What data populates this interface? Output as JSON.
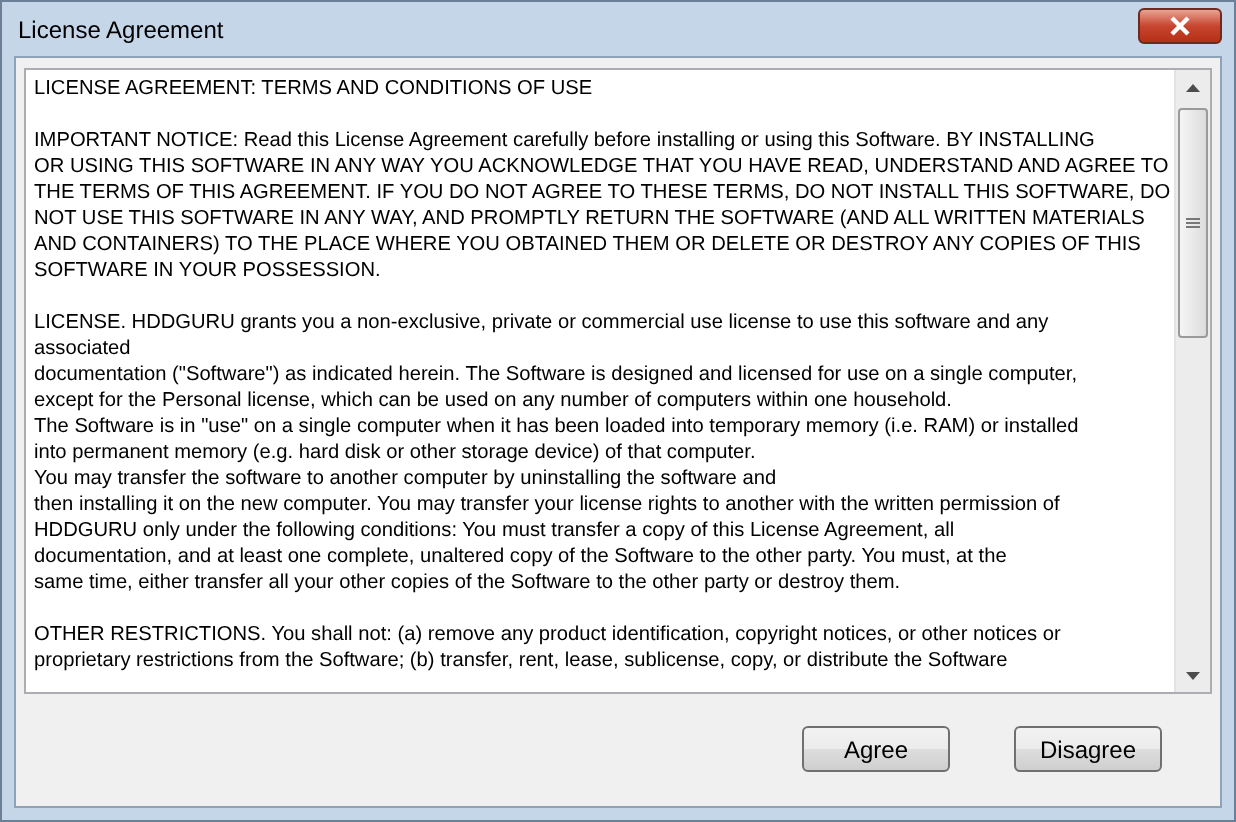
{
  "window": {
    "title": "License Agreement"
  },
  "license_text": {
    "paragraphs": [
      [
        "LICENSE AGREEMENT: TERMS AND CONDITIONS OF USE"
      ],
      [
        "IMPORTANT NOTICE: Read this License Agreement carefully before installing or using this Software. BY INSTALLING",
        "OR USING THIS SOFTWARE IN ANY WAY YOU ACKNOWLEDGE THAT YOU HAVE READ, UNDERSTAND AND AGREE TO",
        "THE TERMS OF THIS AGREEMENT. IF YOU DO NOT AGREE TO THESE TERMS, DO NOT INSTALL THIS SOFTWARE, DO",
        "NOT USE THIS SOFTWARE IN ANY WAY, AND PROMPTLY RETURN THE SOFTWARE (AND ALL WRITTEN MATERIALS",
        "AND CONTAINERS) TO THE PLACE WHERE YOU OBTAINED THEM OR DELETE OR DESTROY ANY COPIES OF THIS",
        "SOFTWARE IN YOUR POSSESSION."
      ],
      [
        "LICENSE. HDDGURU grants you a non-exclusive, private or commercial use license to use this software and any",
        "associated",
        "documentation (\"Software\") as indicated herein.  The Software is designed and licensed for use on a single computer,",
        "except for the Personal license, which can be used on any number of computers within one household.",
        "The Software is in \"use\" on a single computer when it has been loaded into temporary memory (i.e. RAM) or installed",
        "into permanent memory (e.g. hard disk or other storage device) of that computer.",
        "You may transfer the software to another computer by uninstalling the software and",
        "then installing it on the new computer. You may transfer your license rights to another with the written permission of",
        "HDDGURU only under the following conditions: You must transfer a copy of this License Agreement, all",
        "documentation, and at least one complete, unaltered copy of the Software to the other party.  You must, at the",
        "same time, either transfer all your other copies of the Software to the other party or destroy them."
      ],
      [
        "OTHER RESTRICTIONS. You shall not: (a) remove any product identification, copyright notices, or other notices or",
        "proprietary restrictions from the Software; (b) transfer, rent, lease, sublicense, copy, or distribute the Software"
      ]
    ]
  },
  "buttons": [
    {
      "label": "Agree"
    },
    {
      "label": "Disagree"
    }
  ]
}
